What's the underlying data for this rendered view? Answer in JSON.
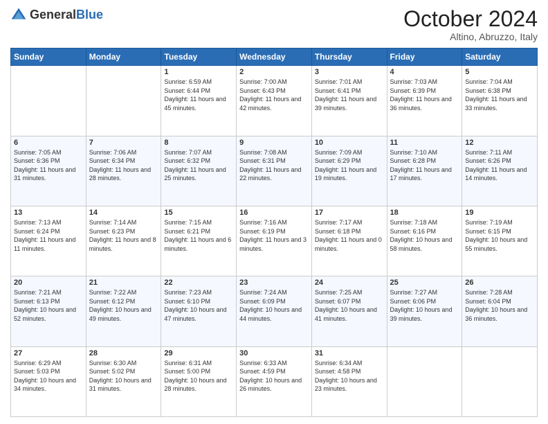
{
  "header": {
    "logo_general": "General",
    "logo_blue": "Blue",
    "month": "October 2024",
    "location": "Altino, Abruzzo, Italy"
  },
  "days": [
    "Sunday",
    "Monday",
    "Tuesday",
    "Wednesday",
    "Thursday",
    "Friday",
    "Saturday"
  ],
  "weeks": [
    [
      {
        "date": "",
        "sunrise": "",
        "sunset": "",
        "daylight": ""
      },
      {
        "date": "",
        "sunrise": "",
        "sunset": "",
        "daylight": ""
      },
      {
        "date": "1",
        "sunrise": "Sunrise: 6:59 AM",
        "sunset": "Sunset: 6:44 PM",
        "daylight": "Daylight: 11 hours and 45 minutes."
      },
      {
        "date": "2",
        "sunrise": "Sunrise: 7:00 AM",
        "sunset": "Sunset: 6:43 PM",
        "daylight": "Daylight: 11 hours and 42 minutes."
      },
      {
        "date": "3",
        "sunrise": "Sunrise: 7:01 AM",
        "sunset": "Sunset: 6:41 PM",
        "daylight": "Daylight: 11 hours and 39 minutes."
      },
      {
        "date": "4",
        "sunrise": "Sunrise: 7:03 AM",
        "sunset": "Sunset: 6:39 PM",
        "daylight": "Daylight: 11 hours and 36 minutes."
      },
      {
        "date": "5",
        "sunrise": "Sunrise: 7:04 AM",
        "sunset": "Sunset: 6:38 PM",
        "daylight": "Daylight: 11 hours and 33 minutes."
      }
    ],
    [
      {
        "date": "6",
        "sunrise": "Sunrise: 7:05 AM",
        "sunset": "Sunset: 6:36 PM",
        "daylight": "Daylight: 11 hours and 31 minutes."
      },
      {
        "date": "7",
        "sunrise": "Sunrise: 7:06 AM",
        "sunset": "Sunset: 6:34 PM",
        "daylight": "Daylight: 11 hours and 28 minutes."
      },
      {
        "date": "8",
        "sunrise": "Sunrise: 7:07 AM",
        "sunset": "Sunset: 6:32 PM",
        "daylight": "Daylight: 11 hours and 25 minutes."
      },
      {
        "date": "9",
        "sunrise": "Sunrise: 7:08 AM",
        "sunset": "Sunset: 6:31 PM",
        "daylight": "Daylight: 11 hours and 22 minutes."
      },
      {
        "date": "10",
        "sunrise": "Sunrise: 7:09 AM",
        "sunset": "Sunset: 6:29 PM",
        "daylight": "Daylight: 11 hours and 19 minutes."
      },
      {
        "date": "11",
        "sunrise": "Sunrise: 7:10 AM",
        "sunset": "Sunset: 6:28 PM",
        "daylight": "Daylight: 11 hours and 17 minutes."
      },
      {
        "date": "12",
        "sunrise": "Sunrise: 7:11 AM",
        "sunset": "Sunset: 6:26 PM",
        "daylight": "Daylight: 11 hours and 14 minutes."
      }
    ],
    [
      {
        "date": "13",
        "sunrise": "Sunrise: 7:13 AM",
        "sunset": "Sunset: 6:24 PM",
        "daylight": "Daylight: 11 hours and 11 minutes."
      },
      {
        "date": "14",
        "sunrise": "Sunrise: 7:14 AM",
        "sunset": "Sunset: 6:23 PM",
        "daylight": "Daylight: 11 hours and 8 minutes."
      },
      {
        "date": "15",
        "sunrise": "Sunrise: 7:15 AM",
        "sunset": "Sunset: 6:21 PM",
        "daylight": "Daylight: 11 hours and 6 minutes."
      },
      {
        "date": "16",
        "sunrise": "Sunrise: 7:16 AM",
        "sunset": "Sunset: 6:19 PM",
        "daylight": "Daylight: 11 hours and 3 minutes."
      },
      {
        "date": "17",
        "sunrise": "Sunrise: 7:17 AM",
        "sunset": "Sunset: 6:18 PM",
        "daylight": "Daylight: 11 hours and 0 minutes."
      },
      {
        "date": "18",
        "sunrise": "Sunrise: 7:18 AM",
        "sunset": "Sunset: 6:16 PM",
        "daylight": "Daylight: 10 hours and 58 minutes."
      },
      {
        "date": "19",
        "sunrise": "Sunrise: 7:19 AM",
        "sunset": "Sunset: 6:15 PM",
        "daylight": "Daylight: 10 hours and 55 minutes."
      }
    ],
    [
      {
        "date": "20",
        "sunrise": "Sunrise: 7:21 AM",
        "sunset": "Sunset: 6:13 PM",
        "daylight": "Daylight: 10 hours and 52 minutes."
      },
      {
        "date": "21",
        "sunrise": "Sunrise: 7:22 AM",
        "sunset": "Sunset: 6:12 PM",
        "daylight": "Daylight: 10 hours and 49 minutes."
      },
      {
        "date": "22",
        "sunrise": "Sunrise: 7:23 AM",
        "sunset": "Sunset: 6:10 PM",
        "daylight": "Daylight: 10 hours and 47 minutes."
      },
      {
        "date": "23",
        "sunrise": "Sunrise: 7:24 AM",
        "sunset": "Sunset: 6:09 PM",
        "daylight": "Daylight: 10 hours and 44 minutes."
      },
      {
        "date": "24",
        "sunrise": "Sunrise: 7:25 AM",
        "sunset": "Sunset: 6:07 PM",
        "daylight": "Daylight: 10 hours and 41 minutes."
      },
      {
        "date": "25",
        "sunrise": "Sunrise: 7:27 AM",
        "sunset": "Sunset: 6:06 PM",
        "daylight": "Daylight: 10 hours and 39 minutes."
      },
      {
        "date": "26",
        "sunrise": "Sunrise: 7:28 AM",
        "sunset": "Sunset: 6:04 PM",
        "daylight": "Daylight: 10 hours and 36 minutes."
      }
    ],
    [
      {
        "date": "27",
        "sunrise": "Sunrise: 6:29 AM",
        "sunset": "Sunset: 5:03 PM",
        "daylight": "Daylight: 10 hours and 34 minutes."
      },
      {
        "date": "28",
        "sunrise": "Sunrise: 6:30 AM",
        "sunset": "Sunset: 5:02 PM",
        "daylight": "Daylight: 10 hours and 31 minutes."
      },
      {
        "date": "29",
        "sunrise": "Sunrise: 6:31 AM",
        "sunset": "Sunset: 5:00 PM",
        "daylight": "Daylight: 10 hours and 28 minutes."
      },
      {
        "date": "30",
        "sunrise": "Sunrise: 6:33 AM",
        "sunset": "Sunset: 4:59 PM",
        "daylight": "Daylight: 10 hours and 26 minutes."
      },
      {
        "date": "31",
        "sunrise": "Sunrise: 6:34 AM",
        "sunset": "Sunset: 4:58 PM",
        "daylight": "Daylight: 10 hours and 23 minutes."
      },
      {
        "date": "",
        "sunrise": "",
        "sunset": "",
        "daylight": ""
      },
      {
        "date": "",
        "sunrise": "",
        "sunset": "",
        "daylight": ""
      }
    ]
  ]
}
